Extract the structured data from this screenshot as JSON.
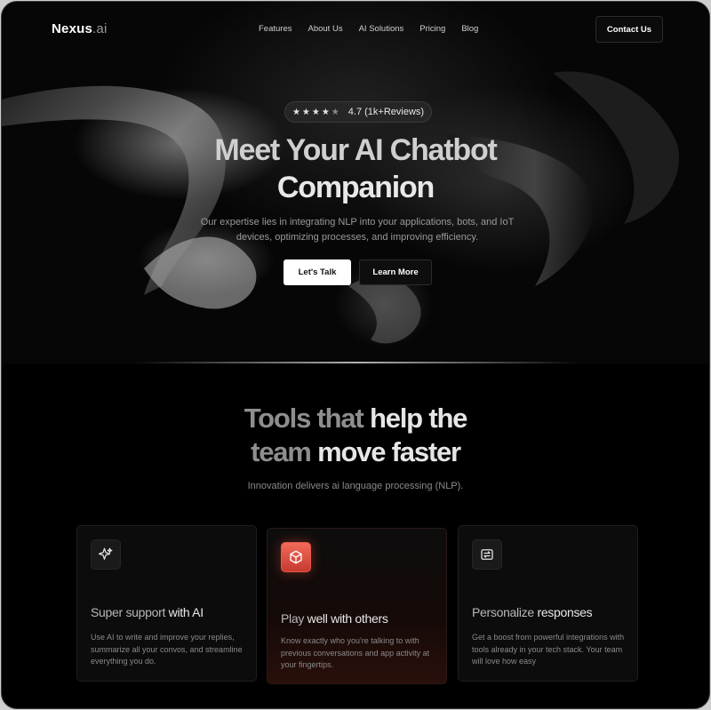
{
  "nav": {
    "logo_main": "Nexus",
    "logo_suffix": ".ai",
    "links": [
      "Features",
      "About Us",
      "AI Solutions",
      "Pricing",
      "Blog"
    ],
    "contact_label": "Contact Us"
  },
  "hero": {
    "rating_stars": 4,
    "rating_text": "4.7 (1k+Reviews)",
    "title_line1_a": "Meet Your AI",
    "title_line1_b": "Chatbot",
    "title_line2": "Companion",
    "subtitle": "Our expertise lies in integrating NLP into your applications, bots, and IoT devices, optimizing processes, and improving efficiency.",
    "primary_button": "Let's Talk",
    "secondary_button": "Learn More"
  },
  "tools": {
    "title_line1_a": "Tools that",
    "title_line1_b": "help the",
    "title_line2_a": "team",
    "title_line2_b": "move faster",
    "subtitle": "Innovation delivers ai language processing (NLP).",
    "cards": [
      {
        "icon": "sparkle-icon",
        "title_a": "Super support",
        "title_b": "with AI",
        "text": "Use AI to write and improve your replies, summarize all your convos, and streamline everything you do."
      },
      {
        "icon": "cube-icon",
        "title_a": "Play",
        "title_b": "well with others",
        "text": "Know exactly who you're talking to with previous conversations and app activity at your fingertips."
      },
      {
        "icon": "swap-arrows-icon",
        "title_a": "Personalize",
        "title_b": "responses",
        "text": "Get a boost from powerful integrations with tools already in your tech stack. Your team will love how easy"
      }
    ]
  },
  "colors": {
    "background": "#000000",
    "accent_red": "#e0503f",
    "text_primary": "#e8e8e8",
    "text_muted": "#8a8a8a"
  }
}
